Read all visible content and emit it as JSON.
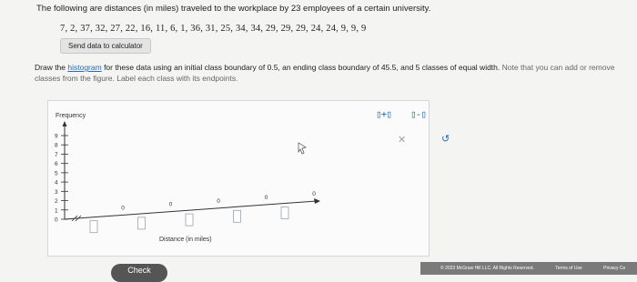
{
  "question": {
    "prompt": "The following are distances (in miles) traveled to the workplace by 23 employees of a certain university.",
    "data_values": "7, 2, 37, 32, 27, 22, 16, 11, 6, 1, 36, 31, 25, 34, 34, 29, 29, 29, 24, 24, 9, 9, 9",
    "send_button": "Send data to calculator",
    "instructions_before_link": "Draw the ",
    "instructions_link": "histogram",
    "instructions_after_link": " for these data using an initial class boundary of 0.5, an ending class boundary of 45.5, and 5 classes of equal width. ",
    "instructions_note": "Note that you can add or remove classes from the figure. Label each class with its endpoints."
  },
  "graph": {
    "ylabel": "Frequency",
    "xlabel": "Distance (in miles)",
    "y_ticks": [
      "0",
      "1",
      "2",
      "3",
      "4",
      "5",
      "6",
      "7",
      "8",
      "9"
    ],
    "bar_values": [
      "0",
      "0",
      "0",
      "0",
      "0"
    ]
  },
  "tools": {
    "add_class": "▯+▯",
    "remove_class": "▯-▯",
    "clear_icon": "x-icon",
    "undo_icon": "undo-icon"
  },
  "check_button": "Check",
  "footer": {
    "copyright": "© 2023 McGraw Hill LLC. All Rights Reserved.",
    "terms": "Terms of Use",
    "privacy": "Privacy Ce"
  }
}
